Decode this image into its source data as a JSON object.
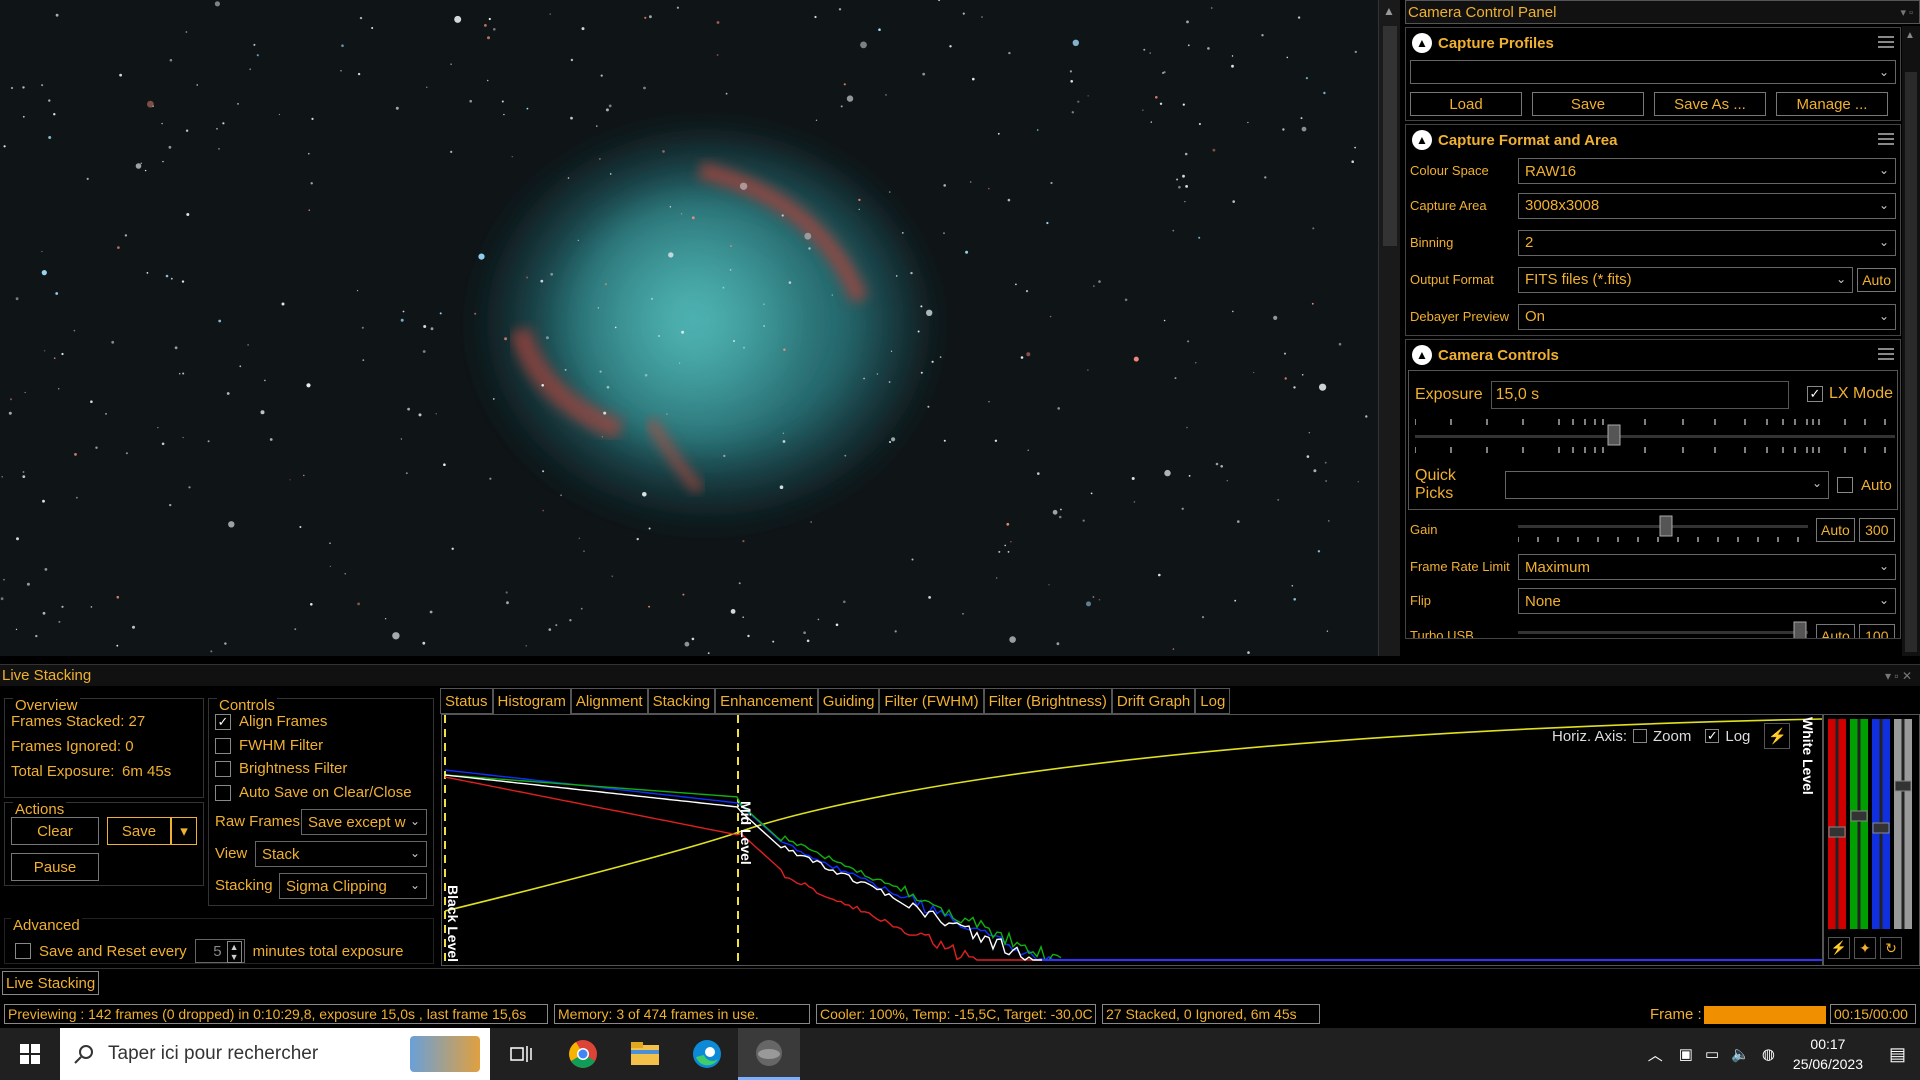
{
  "right_panel": {
    "title": "Camera Control Panel",
    "capture_profiles": {
      "title": "Capture Profiles",
      "profile_value": "",
      "buttons": [
        "Load",
        "Save",
        "Save As ...",
        "Manage ..."
      ]
    },
    "capture_format": {
      "title": "Capture Format and Area",
      "rows": [
        {
          "label": "Colour Space",
          "value": "RAW16"
        },
        {
          "label": "Capture Area",
          "value": "3008x3008"
        },
        {
          "label": "Binning",
          "value": "2"
        },
        {
          "label": "Output Format",
          "value": "FITS files (*.fits)",
          "extra": "Auto"
        },
        {
          "label": "Debayer Preview",
          "value": "On"
        }
      ]
    },
    "camera_controls": {
      "title": "Camera Controls",
      "exposure_label": "Exposure",
      "exposure_value": "15,0 s",
      "lx_mode_label": "LX Mode",
      "lx_mode_checked": true,
      "quick_picks_label": "Quick Picks",
      "quick_picks_value": "",
      "quick_picks_auto": "Auto",
      "gain_label": "Gain",
      "gain_auto": "Auto",
      "gain_value": "300",
      "frame_rate_label": "Frame Rate Limit",
      "frame_rate_value": "Maximum",
      "flip_label": "Flip",
      "flip_value": "None",
      "turbo_label": "Turbo USB",
      "turbo_auto": "Auto",
      "turbo_value": "100"
    }
  },
  "live_stacking": {
    "title": "Live Stacking",
    "overview": {
      "title": "Overview",
      "frames_stacked": "Frames Stacked: 27",
      "frames_ignored": "Frames Ignored: 0",
      "total_exposure_label": "Total Exposure:",
      "total_exposure_value": "6m 45s"
    },
    "actions": {
      "title": "Actions",
      "clear": "Clear",
      "save": "Save",
      "pause": "Pause"
    },
    "advanced": {
      "title": "Advanced",
      "save_reset_label": "Save and Reset every",
      "save_reset_value": "5",
      "minutes_label": "minutes total exposure"
    },
    "controls": {
      "title": "Controls",
      "align_frames": "Align Frames",
      "fwhm_filter": "FWHM Filter",
      "brightness_filter": "Brightness Filter",
      "auto_save": "Auto Save on Clear/Close",
      "raw_frames_label": "Raw Frames",
      "raw_frames_value": "Save except w",
      "view_label": "View",
      "view_value": "Stack",
      "stacking_label": "Stacking",
      "stacking_value": "Sigma Clipping"
    },
    "tabs": [
      "Status",
      "Histogram",
      "Alignment",
      "Stacking",
      "Enhancement",
      "Guiding",
      "Filter (FWHM)",
      "Filter (Brightness)",
      "Drift Graph",
      "Log"
    ],
    "active_tab": "Histogram",
    "histogram": {
      "horiz_axis_label": "Horiz. Axis:",
      "zoom_label": "Zoom",
      "log_label": "Log",
      "black_level": "Black Level",
      "mid_level": "Mid Level",
      "white_level": "White Level"
    },
    "bottom_tab": "Live Stacking"
  },
  "status_bar": {
    "previewing": "Previewing : 142 frames (0 dropped) in 0:10:29,8, exposure 15,0s , last frame 15,6s",
    "memory": "Memory: 3 of 474 frames in use.",
    "cooler": "Cooler: 100%, Temp: -15,5C, Target: -30,0C",
    "stacked": "27 Stacked, 0 Ignored, 6m 45s",
    "frame_label": "Frame :",
    "frame_time": "00:15/00:00"
  },
  "taskbar": {
    "search_placeholder": "Taper ici pour rechercher",
    "time": "00:17",
    "date": "25/06/2023"
  }
}
